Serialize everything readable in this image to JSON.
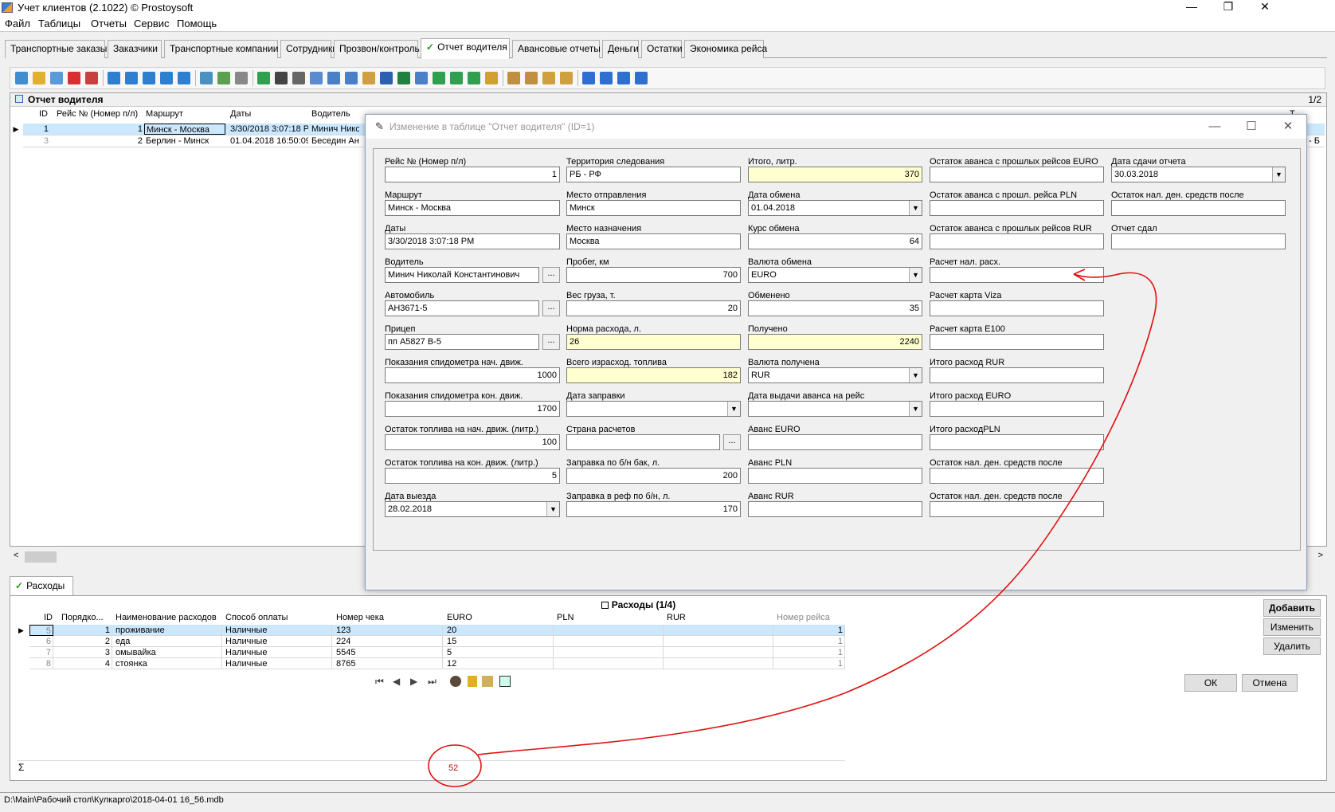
{
  "window": {
    "title": "Учет клиентов (2.1022) © Prostoysoft",
    "minimize": "—",
    "maximize": "❐",
    "close": "✕"
  },
  "menu": [
    "Файл",
    "Таблицы",
    "Отчеты",
    "Сервис",
    "Помощь"
  ],
  "tabs": [
    "Транспортные заказы",
    "Заказчики",
    "Транспортные компании",
    "Сотрудники",
    "Прозвон/контроль",
    "Отчет водителя",
    "Авансовые отчеты",
    "Деньги",
    "Остатки",
    "Экономика рейса"
  ],
  "main": {
    "title": "Отчет водителя",
    "page": "1/2",
    "headers": [
      "ID",
      "Рейс № (Номер п/л)",
      "Маршрут",
      "Даты",
      "Водитель"
    ],
    "rows": [
      {
        "id": "1",
        "num": "1",
        "route": "Минск - Москва",
        "date": "3/30/2018 3:07:18 P",
        "driver": "Минич Нико"
      },
      {
        "id": "3",
        "num": "2",
        "route": "Берлин - Минск",
        "date": "01.04.2018 16:50:09",
        "driver": "Беседин Ан"
      }
    ],
    "right_edge": [
      "Т",
      "- Б"
    ]
  },
  "dialog": {
    "title": "Изменение в таблице \"Отчет водителя\" (ID=1)",
    "col1": [
      {
        "label": "Рейс № (Номер п/л)",
        "value": "1"
      },
      {
        "label": "Маршрут",
        "value": "Минск - Москва"
      },
      {
        "label": "Даты",
        "value": "3/30/2018 3:07:18 PM"
      },
      {
        "label": "Водитель",
        "value": "Минич Николай Константинович"
      },
      {
        "label": "Автомобиль",
        "value": "АН3671-5"
      },
      {
        "label": "Прицеп",
        "value": "пп А5827 В-5"
      },
      {
        "label": "Показания спидометра нач. движ.",
        "value": "1000"
      },
      {
        "label": "Показания спидометра кон. движ.",
        "value": "1700"
      },
      {
        "label": "Остаток топлива на нач. движ. (литр.)",
        "value": "100"
      },
      {
        "label": "Остаток топлива на кон. движ. (литр.)",
        "value": "5"
      },
      {
        "label": "Дата выезда",
        "value": "28.02.2018"
      }
    ],
    "col2": [
      {
        "label": "Территория следования",
        "value": "РБ - РФ"
      },
      {
        "label": "Место отправления",
        "value": "Минск"
      },
      {
        "label": "Место назначения",
        "value": "Москва"
      },
      {
        "label": "Пробег, км",
        "value": "700"
      },
      {
        "label": "Вес груза, т.",
        "value": "20"
      },
      {
        "label": "Норма расхода, л.",
        "value": "26"
      },
      {
        "label": "Всего израсход. топлива",
        "value": "182"
      },
      {
        "label": "Дата заправки",
        "value": ""
      },
      {
        "label": "Страна расчетов",
        "value": ""
      },
      {
        "label": "Заправка по б/н бак, л.",
        "value": "200"
      },
      {
        "label": "Заправка в реф по б/н, л.",
        "value": "170"
      }
    ],
    "col3": [
      {
        "label": "Итого, литр.",
        "value": "370"
      },
      {
        "label": "Дата обмена",
        "value": "01.04.2018"
      },
      {
        "label": "Курс обмена",
        "value": "64"
      },
      {
        "label": "Валюта обмена",
        "value": "EURO"
      },
      {
        "label": "Обменено",
        "value": "35"
      },
      {
        "label": "Получено",
        "value": "2240"
      },
      {
        "label": "Валюта получена",
        "value": "RUR"
      },
      {
        "label": "Дата выдачи аванса на рейс",
        "value": ""
      },
      {
        "label": "Аванс EURO",
        "value": ""
      },
      {
        "label": "Аванс PLN",
        "value": ""
      },
      {
        "label": "Аванс RUR",
        "value": ""
      }
    ],
    "col4": [
      {
        "label": "Остаток аванса с прошлых рейсов  EURO",
        "value": ""
      },
      {
        "label": "Остаток аванса с прошл. рейса PLN",
        "value": ""
      },
      {
        "label": "Остаток аванса с прошлых рейсов  RUR",
        "value": ""
      },
      {
        "label": "Расчет нал. расх.",
        "value": ""
      },
      {
        "label": "Расчет карта Viza",
        "value": ""
      },
      {
        "label": "Расчет карта E100",
        "value": ""
      },
      {
        "label": "Итого расход RUR",
        "value": ""
      },
      {
        "label": "Итого расход EURO",
        "value": ""
      },
      {
        "label": "Итого расходPLN",
        "value": ""
      },
      {
        "label": "Остаток нал. ден. средств после",
        "value": ""
      },
      {
        "label": "Остаток нал. ден. средств после",
        "value": ""
      }
    ],
    "col5": [
      {
        "label": "Дата сдачи отчета",
        "value": "30.03.2018"
      },
      {
        "label": "Остаток нал. ден. средств после",
        "value": ""
      },
      {
        "label": "Отчет сдал",
        "value": ""
      }
    ],
    "ok": "ОК",
    "cancel": "Отмена",
    "ellipsis": "...",
    "dropdown": "▼",
    "combo": "▼"
  },
  "expenses": {
    "tab": "Расходы",
    "title": "Расходы (1/4)",
    "headers": [
      "ID",
      "Порядко...",
      "Наименование расходов",
      "Способ оплаты",
      "Номер чека",
      "EURO",
      "PLN",
      "RUR",
      "Номер рейса"
    ],
    "rows": [
      {
        "id": "5",
        "ord": "1",
        "name": "проживание",
        "pay": "Наличные",
        "check": "123",
        "euro": "20",
        "pln": "",
        "rur": "",
        "trip": "1"
      },
      {
        "id": "6",
        "ord": "2",
        "name": "еда",
        "pay": "Наличные",
        "check": "224",
        "euro": "15",
        "pln": "",
        "rur": "",
        "trip": "1"
      },
      {
        "id": "7",
        "ord": "3",
        "name": "омывайка",
        "pay": "Наличные",
        "check": "5545",
        "euro": "5",
        "pln": "",
        "rur": "",
        "trip": "1"
      },
      {
        "id": "8",
        "ord": "4",
        "name": "стоянка",
        "pay": "Наличные",
        "check": "8765",
        "euro": "12",
        "pln": "",
        "rur": "",
        "trip": "1"
      }
    ],
    "sum_symbol": "Σ",
    "sum_euro": "52",
    "buttons": {
      "add": "Добавить",
      "edit": "Изменить",
      "delete": "Удалить"
    }
  },
  "statusbar": "D:\\Main\\Рабочий стол\\Кулкарго\\2018-04-01 16_56.mdb",
  "colors": {
    "highlight_yellow": "#ffffd0",
    "selection_blue": "#cce8ff",
    "annotation_red": "#e01010",
    "active_tab_tick": "#1f9a1f"
  }
}
